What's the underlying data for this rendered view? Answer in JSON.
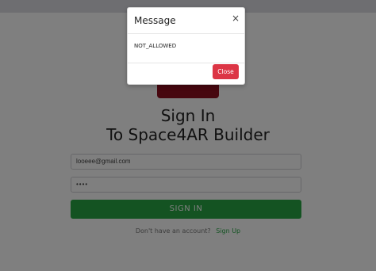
{
  "signin": {
    "title_line1": "Sign In",
    "title_line2": "To Space4AR Builder",
    "email_value": "looeee@gmail.com",
    "password_value": "••••",
    "button_label": "SIGN IN",
    "no_account_text": "Don't have an account?",
    "signup_label": "Sign Up"
  },
  "modal": {
    "title": "Message",
    "close_icon": "×",
    "message": "NOT_ALLOWED",
    "close_label": "Close"
  },
  "colors": {
    "brand": "#8e0f1f",
    "primary_button": "#28a745",
    "danger_button": "#dc3545"
  }
}
